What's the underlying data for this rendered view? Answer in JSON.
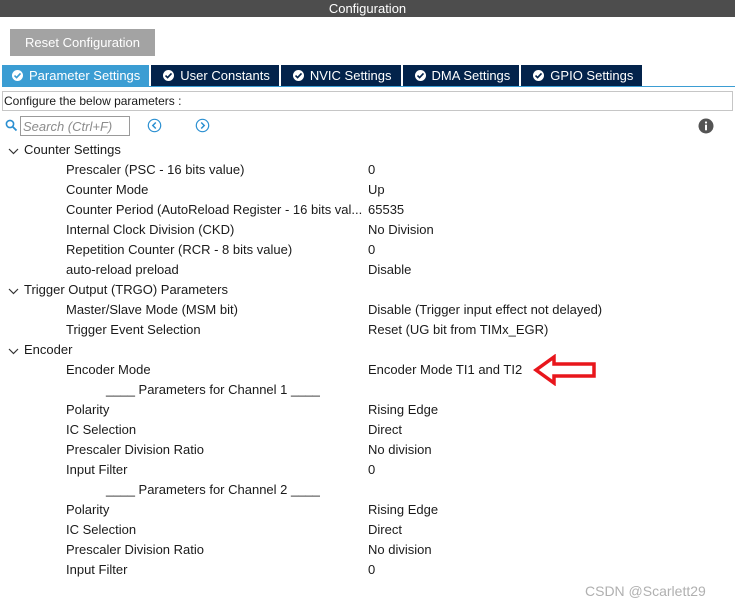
{
  "window": {
    "title": "Configuration"
  },
  "toolbar": {
    "reset_label": "Reset Configuration"
  },
  "tabs": [
    {
      "label": "Parameter Settings",
      "active": true
    },
    {
      "label": "User Constants",
      "active": false
    },
    {
      "label": "NVIC Settings",
      "active": false
    },
    {
      "label": "DMA Settings",
      "active": false
    },
    {
      "label": "GPIO Settings",
      "active": false
    }
  ],
  "configure_text": "Configure the below parameters :",
  "search": {
    "placeholder": "Search (Ctrl+F)"
  },
  "groups": {
    "counter": {
      "title": "Counter Settings",
      "params": [
        {
          "name": "Prescaler (PSC - 16 bits value)",
          "value": "0"
        },
        {
          "name": "Counter Mode",
          "value": "Up"
        },
        {
          "name": "Counter Period (AutoReload Register - 16 bits val...",
          "value": "65535"
        },
        {
          "name": "Internal Clock Division (CKD)",
          "value": "No Division"
        },
        {
          "name": "Repetition Counter (RCR - 8 bits value)",
          "value": "0"
        },
        {
          "name": "auto-reload preload",
          "value": "Disable"
        }
      ]
    },
    "trgo": {
      "title": "Trigger Output (TRGO) Parameters",
      "params": [
        {
          "name": "Master/Slave Mode (MSM bit)",
          "value": "Disable (Trigger input effect not delayed)"
        },
        {
          "name": "Trigger Event Selection",
          "value": "Reset (UG bit from TIMx_EGR)"
        }
      ]
    },
    "encoder": {
      "title": "Encoder",
      "mode": {
        "name": "Encoder Mode",
        "value": "Encoder Mode TI1 and TI2"
      },
      "ch1_header": "____ Parameters for Channel 1 ____",
      "ch1": [
        {
          "name": "Polarity",
          "value": "Rising Edge"
        },
        {
          "name": "IC Selection",
          "value": "Direct"
        },
        {
          "name": "Prescaler Division Ratio",
          "value": "No division"
        },
        {
          "name": "Input Filter",
          "value": "0"
        }
      ],
      "ch2_header": "____ Parameters for Channel 2 ____",
      "ch2": [
        {
          "name": "Polarity",
          "value": "Rising Edge"
        },
        {
          "name": "IC Selection",
          "value": "Direct"
        },
        {
          "name": "Prescaler Division Ratio",
          "value": "No division"
        },
        {
          "name": "Input Filter",
          "value": "0"
        }
      ]
    }
  },
  "annotation": {
    "arrow_color": "#e8161c"
  },
  "watermark": "CSDN @Scarlett29",
  "colors": {
    "tab_active": "#3b9dd3",
    "tab_inactive": "#03234b",
    "titlebar": "#4d4d4d",
    "button": "#a3a3a3"
  }
}
